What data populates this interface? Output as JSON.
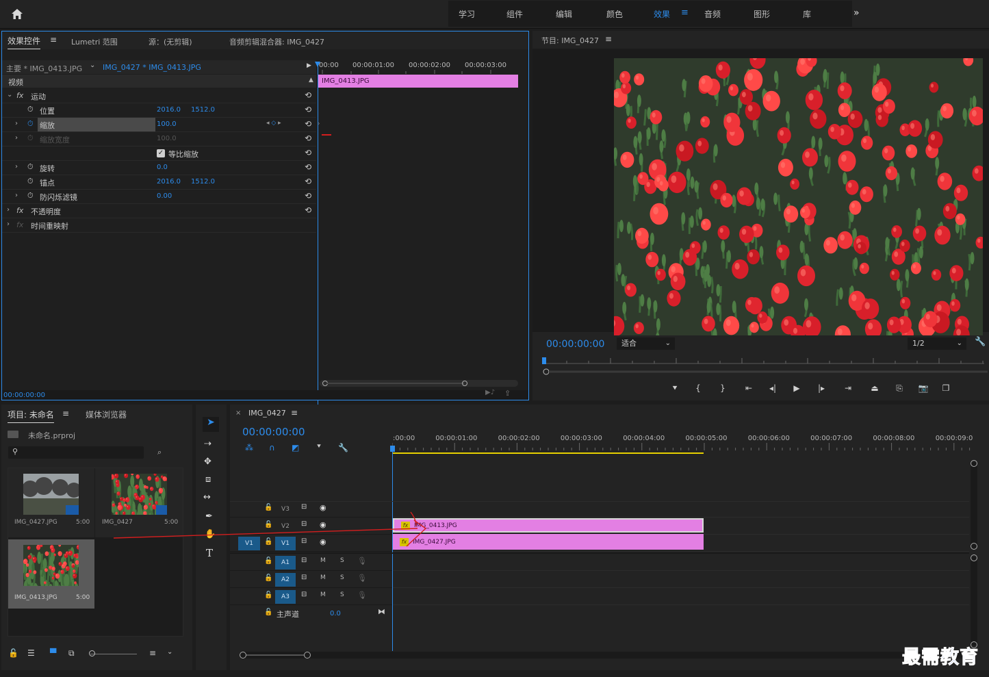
{
  "workspace_tabs": [
    "学习",
    "组件",
    "编辑",
    "颜色",
    "效果",
    "音频",
    "图形",
    "库"
  ],
  "active_tab_index": 4,
  "effect_panel": {
    "tabs": [
      "效果控件",
      "Lumetri 范围",
      "源：(无剪辑)",
      "音频剪辑混合器: IMG_0427"
    ],
    "master": "主要 * IMG_0413.JPG",
    "clip": "IMG_0427 * IMG_0413.JPG",
    "video_label": "视频",
    "ruler": [
      "00:00",
      "00:00:01:00",
      "00:00:02:00",
      "00:00:03:00"
    ],
    "clip_bar": "IMG_0413.JPG",
    "motion": "运动",
    "position": {
      "label": "位置",
      "x": "2016.0",
      "y": "1512.0"
    },
    "scale": {
      "label": "缩放",
      "value": "100.0"
    },
    "scale_width": {
      "label": "缩放宽度",
      "value": "100.0"
    },
    "uniform": "等比缩放",
    "rotation": {
      "label": "旋转",
      "value": "0.0"
    },
    "anchor": {
      "label": "锚点",
      "x": "2016.0",
      "y": "1512.0"
    },
    "flicker": {
      "label": "防闪烁滤镜",
      "value": "0.00"
    },
    "opacity": "不透明度",
    "time_remap": "时间重映射",
    "fx_label": "fx",
    "timecode": "00:00:00:00"
  },
  "program": {
    "title": "节目: IMG_0427",
    "timecode": "00:00:00:00",
    "fit": "适合",
    "quality": "1/2"
  },
  "project": {
    "tabs": [
      "项目: 未命名",
      "媒体浏览器"
    ],
    "file": "未命名.prproj",
    "items": [
      {
        "name": "IMG_0427.JPG",
        "dur": "5:00"
      },
      {
        "name": "IMG_0427",
        "dur": "5:00"
      },
      {
        "name": "IMG_0413.JPG",
        "dur": "5:00"
      }
    ]
  },
  "timeline": {
    "title": "IMG_0427",
    "timecode": "00:00:00:00",
    "ruler": [
      ":00:00",
      "00:00:01:00",
      "00:00:02:00",
      "00:00:03:00",
      "00:00:04:00",
      "00:00:05:00",
      "00:00:06:00",
      "00:00:07:00",
      "00:00:08:00",
      "00:00:09:0"
    ],
    "video_tracks": [
      "V3",
      "V2",
      "V1"
    ],
    "source_patch": "V1",
    "audio_tracks": [
      "A1",
      "A2",
      "A3"
    ],
    "mute": "M",
    "solo": "S",
    "master": {
      "label": "主声道",
      "value": "0.0"
    },
    "clips": {
      "v2": "IMG_0413.JPG",
      "v1": "IMG_0427.JPG"
    }
  },
  "watermark": "最需教育",
  "colors": {
    "accent": "#2d8ceb",
    "clip": "#e37fe3",
    "work_area": "#e6d000"
  }
}
